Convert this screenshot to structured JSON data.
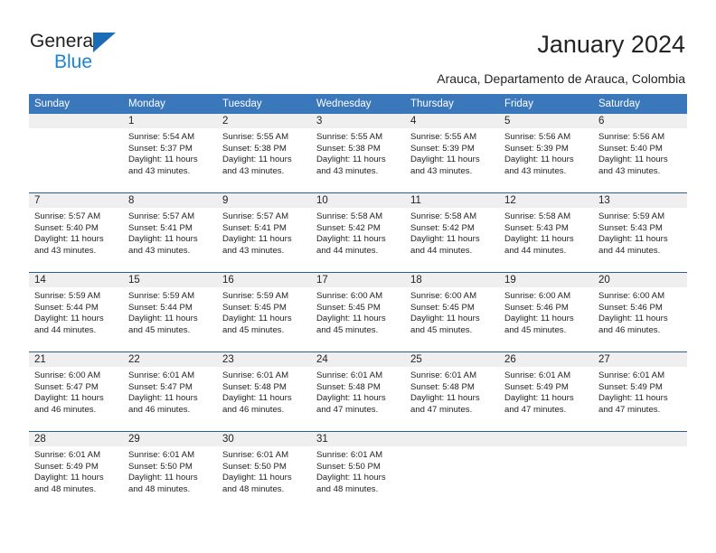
{
  "brand": {
    "name_part1": "General",
    "name_part2": "Blue",
    "triangle_color": "#1c6cb5",
    "blue_color": "#1c84d6"
  },
  "header": {
    "title": "January 2024",
    "subtitle": "Arauca, Departamento de Arauca, Colombia"
  },
  "colors": {
    "header_bg": "#3b78bb",
    "header_text": "#ffffff",
    "daynum_band": "#efefef",
    "week_divider": "#2a6099",
    "text": "#232323"
  },
  "calendar": {
    "weekday_headers": [
      "Sunday",
      "Monday",
      "Tuesday",
      "Wednesday",
      "Thursday",
      "Friday",
      "Saturday"
    ],
    "weeks": [
      [
        {
          "day": "",
          "empty": true,
          "lines": []
        },
        {
          "day": "1",
          "empty": false,
          "lines": [
            "Sunrise: 5:54 AM",
            "Sunset: 5:37 PM",
            "Daylight: 11 hours",
            "and 43 minutes."
          ]
        },
        {
          "day": "2",
          "empty": false,
          "lines": [
            "Sunrise: 5:55 AM",
            "Sunset: 5:38 PM",
            "Daylight: 11 hours",
            "and 43 minutes."
          ]
        },
        {
          "day": "3",
          "empty": false,
          "lines": [
            "Sunrise: 5:55 AM",
            "Sunset: 5:38 PM",
            "Daylight: 11 hours",
            "and 43 minutes."
          ]
        },
        {
          "day": "4",
          "empty": false,
          "lines": [
            "Sunrise: 5:55 AM",
            "Sunset: 5:39 PM",
            "Daylight: 11 hours",
            "and 43 minutes."
          ]
        },
        {
          "day": "5",
          "empty": false,
          "lines": [
            "Sunrise: 5:56 AM",
            "Sunset: 5:39 PM",
            "Daylight: 11 hours",
            "and 43 minutes."
          ]
        },
        {
          "day": "6",
          "empty": false,
          "lines": [
            "Sunrise: 5:56 AM",
            "Sunset: 5:40 PM",
            "Daylight: 11 hours",
            "and 43 minutes."
          ]
        }
      ],
      [
        {
          "day": "7",
          "empty": false,
          "lines": [
            "Sunrise: 5:57 AM",
            "Sunset: 5:40 PM",
            "Daylight: 11 hours",
            "and 43 minutes."
          ]
        },
        {
          "day": "8",
          "empty": false,
          "lines": [
            "Sunrise: 5:57 AM",
            "Sunset: 5:41 PM",
            "Daylight: 11 hours",
            "and 43 minutes."
          ]
        },
        {
          "day": "9",
          "empty": false,
          "lines": [
            "Sunrise: 5:57 AM",
            "Sunset: 5:41 PM",
            "Daylight: 11 hours",
            "and 43 minutes."
          ]
        },
        {
          "day": "10",
          "empty": false,
          "lines": [
            "Sunrise: 5:58 AM",
            "Sunset: 5:42 PM",
            "Daylight: 11 hours",
            "and 44 minutes."
          ]
        },
        {
          "day": "11",
          "empty": false,
          "lines": [
            "Sunrise: 5:58 AM",
            "Sunset: 5:42 PM",
            "Daylight: 11 hours",
            "and 44 minutes."
          ]
        },
        {
          "day": "12",
          "empty": false,
          "lines": [
            "Sunrise: 5:58 AM",
            "Sunset: 5:43 PM",
            "Daylight: 11 hours",
            "and 44 minutes."
          ]
        },
        {
          "day": "13",
          "empty": false,
          "lines": [
            "Sunrise: 5:59 AM",
            "Sunset: 5:43 PM",
            "Daylight: 11 hours",
            "and 44 minutes."
          ]
        }
      ],
      [
        {
          "day": "14",
          "empty": false,
          "lines": [
            "Sunrise: 5:59 AM",
            "Sunset: 5:44 PM",
            "Daylight: 11 hours",
            "and 44 minutes."
          ]
        },
        {
          "day": "15",
          "empty": false,
          "lines": [
            "Sunrise: 5:59 AM",
            "Sunset: 5:44 PM",
            "Daylight: 11 hours",
            "and 45 minutes."
          ]
        },
        {
          "day": "16",
          "empty": false,
          "lines": [
            "Sunrise: 5:59 AM",
            "Sunset: 5:45 PM",
            "Daylight: 11 hours",
            "and 45 minutes."
          ]
        },
        {
          "day": "17",
          "empty": false,
          "lines": [
            "Sunrise: 6:00 AM",
            "Sunset: 5:45 PM",
            "Daylight: 11 hours",
            "and 45 minutes."
          ]
        },
        {
          "day": "18",
          "empty": false,
          "lines": [
            "Sunrise: 6:00 AM",
            "Sunset: 5:45 PM",
            "Daylight: 11 hours",
            "and 45 minutes."
          ]
        },
        {
          "day": "19",
          "empty": false,
          "lines": [
            "Sunrise: 6:00 AM",
            "Sunset: 5:46 PM",
            "Daylight: 11 hours",
            "and 45 minutes."
          ]
        },
        {
          "day": "20",
          "empty": false,
          "lines": [
            "Sunrise: 6:00 AM",
            "Sunset: 5:46 PM",
            "Daylight: 11 hours",
            "and 46 minutes."
          ]
        }
      ],
      [
        {
          "day": "21",
          "empty": false,
          "lines": [
            "Sunrise: 6:00 AM",
            "Sunset: 5:47 PM",
            "Daylight: 11 hours",
            "and 46 minutes."
          ]
        },
        {
          "day": "22",
          "empty": false,
          "lines": [
            "Sunrise: 6:01 AM",
            "Sunset: 5:47 PM",
            "Daylight: 11 hours",
            "and 46 minutes."
          ]
        },
        {
          "day": "23",
          "empty": false,
          "lines": [
            "Sunrise: 6:01 AM",
            "Sunset: 5:48 PM",
            "Daylight: 11 hours",
            "and 46 minutes."
          ]
        },
        {
          "day": "24",
          "empty": false,
          "lines": [
            "Sunrise: 6:01 AM",
            "Sunset: 5:48 PM",
            "Daylight: 11 hours",
            "and 47 minutes."
          ]
        },
        {
          "day": "25",
          "empty": false,
          "lines": [
            "Sunrise: 6:01 AM",
            "Sunset: 5:48 PM",
            "Daylight: 11 hours",
            "and 47 minutes."
          ]
        },
        {
          "day": "26",
          "empty": false,
          "lines": [
            "Sunrise: 6:01 AM",
            "Sunset: 5:49 PM",
            "Daylight: 11 hours",
            "and 47 minutes."
          ]
        },
        {
          "day": "27",
          "empty": false,
          "lines": [
            "Sunrise: 6:01 AM",
            "Sunset: 5:49 PM",
            "Daylight: 11 hours",
            "and 47 minutes."
          ]
        }
      ],
      [
        {
          "day": "28",
          "empty": false,
          "lines": [
            "Sunrise: 6:01 AM",
            "Sunset: 5:49 PM",
            "Daylight: 11 hours",
            "and 48 minutes."
          ]
        },
        {
          "day": "29",
          "empty": false,
          "lines": [
            "Sunrise: 6:01 AM",
            "Sunset: 5:50 PM",
            "Daylight: 11 hours",
            "and 48 minutes."
          ]
        },
        {
          "day": "30",
          "empty": false,
          "lines": [
            "Sunrise: 6:01 AM",
            "Sunset: 5:50 PM",
            "Daylight: 11 hours",
            "and 48 minutes."
          ]
        },
        {
          "day": "31",
          "empty": false,
          "lines": [
            "Sunrise: 6:01 AM",
            "Sunset: 5:50 PM",
            "Daylight: 11 hours",
            "and 48 minutes."
          ]
        },
        {
          "day": "",
          "empty": true,
          "lines": []
        },
        {
          "day": "",
          "empty": true,
          "lines": []
        },
        {
          "day": "",
          "empty": true,
          "lines": []
        }
      ]
    ]
  }
}
